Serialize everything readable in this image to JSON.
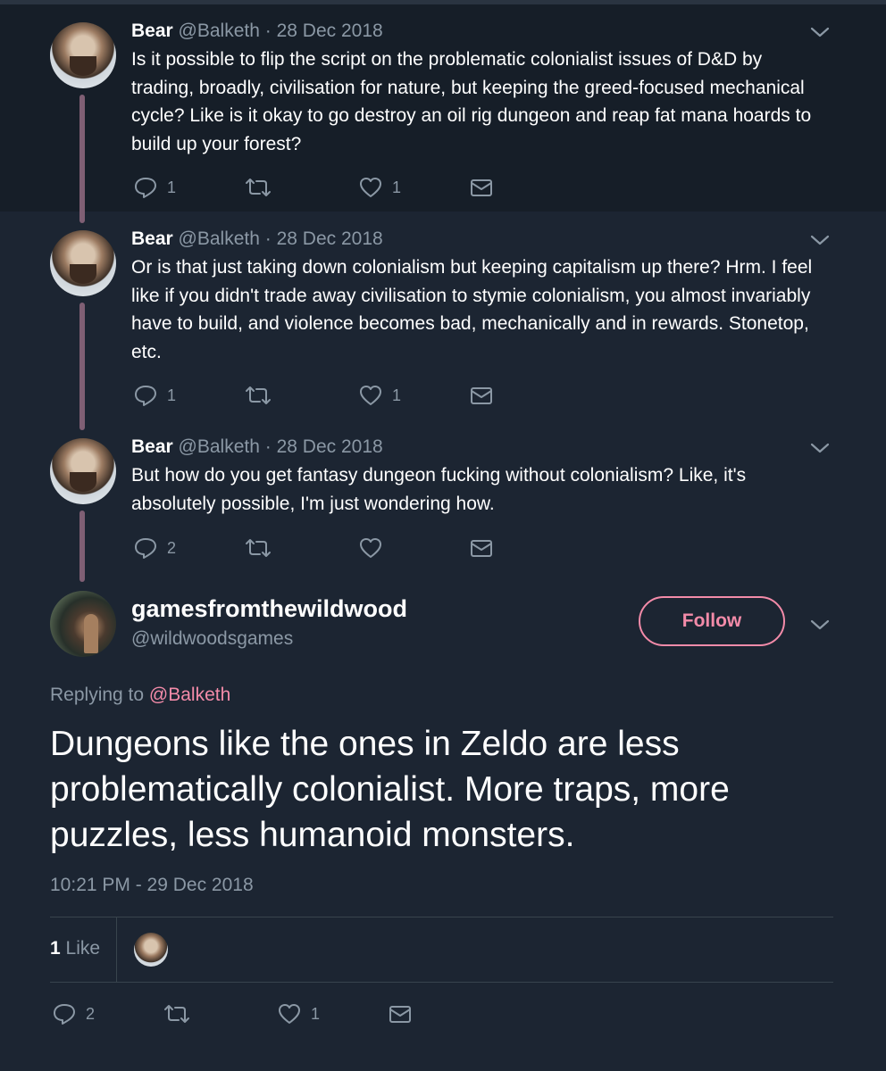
{
  "tweets": [
    {
      "name": "Bear",
      "handle": "@Balketh",
      "date": "· 28 Dec 2018",
      "text": "Is it possible to flip the script on the problematic colonialist issues of D&D by trading, broadly, civilisation for nature, but keeping the greed-focused mechanical cycle? Like is it okay to go destroy an oil rig dungeon and reap fat mana hoards to build up your forest?",
      "replies": "1",
      "retweets": "",
      "likes": "1"
    },
    {
      "name": "Bear",
      "handle": "@Balketh",
      "date": "· 28 Dec 2018",
      "text": "Or is that just taking down colonialism but keeping capitalism up there? Hrm. I feel like if you didn't trade away civilisation to stymie colonialism, you almost invariably have to build, and violence becomes bad, mechanically and in rewards. Stonetop, etc.",
      "replies": "1",
      "retweets": "",
      "likes": "1"
    },
    {
      "name": "Bear",
      "handle": "@Balketh",
      "date": "· 28 Dec 2018",
      "text": "But how do you get fantasy dungeon fucking without colonialism? Like, it's absolutely possible, I'm just wondering how.",
      "replies": "2",
      "retweets": "",
      "likes": ""
    }
  ],
  "focused": {
    "name": "gamesfromthewildwood",
    "handle": "@wildwoodsgames",
    "follow_label": "Follow",
    "replying_prefix": "Replying to",
    "replying_to": "@Balketh",
    "text": "Dungeons like the ones in Zeldo are less problematically colonialist. More traps, more puzzles, less humanoid monsters.",
    "timestamp": "10:21 PM - 29 Dec 2018",
    "like_count": "1",
    "like_label": "Like",
    "replies": "2",
    "retweets": "",
    "likes": "1"
  },
  "colors": {
    "background": "#1c2532",
    "accent": "#f38ba9",
    "muted": "#8b98a5",
    "thread_line": "#7f5f74"
  },
  "icons": [
    "reply-icon",
    "retweet-icon",
    "heart-icon",
    "message-icon",
    "chevron-down-icon"
  ]
}
